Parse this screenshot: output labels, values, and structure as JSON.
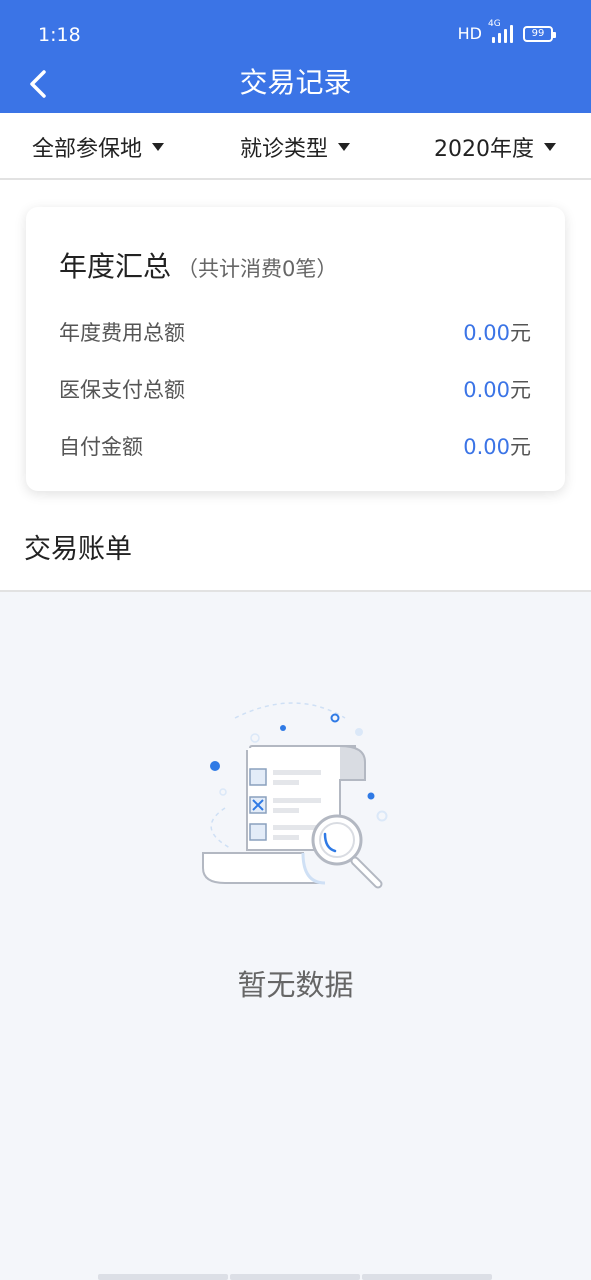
{
  "status": {
    "time": "1:18",
    "hd": "HD",
    "network": "4G",
    "battery": "99"
  },
  "header": {
    "title": "交易记录"
  },
  "filters": [
    {
      "label": "全部参保地"
    },
    {
      "label": "就诊类型"
    },
    {
      "label": "2020年度"
    }
  ],
  "summary": {
    "title": "年度汇总",
    "subtitle": "（共计消费0笔）",
    "rows": [
      {
        "label": "年度费用总额",
        "value": "0.00",
        "unit": "元"
      },
      {
        "label": "医保支付总额",
        "value": "0.00",
        "unit": "元"
      },
      {
        "label": "自付金额",
        "value": "0.00",
        "unit": "元"
      }
    ]
  },
  "bills": {
    "title": "交易账单",
    "empty_text": "暂无数据"
  },
  "colors": {
    "primary": "#3b74e6",
    "background": "#f4f6fa"
  }
}
